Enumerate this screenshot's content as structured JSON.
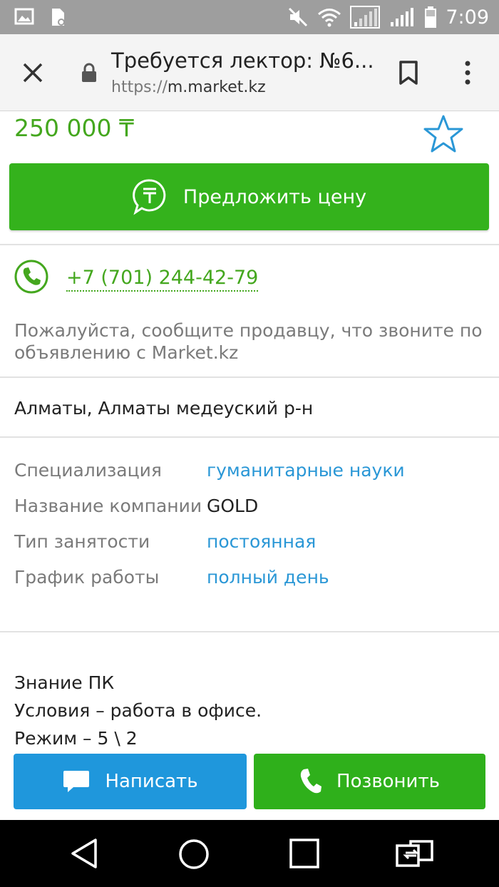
{
  "status_bar": {
    "time": "7:09",
    "icons": [
      "gallery-icon",
      "file-settings-icon",
      "mute-icon",
      "wifi-icon",
      "signal-sim1-icon",
      "signal-sim2-icon",
      "battery-icon"
    ]
  },
  "browser": {
    "title": "Требуется лектор: №6...",
    "url_scheme": "https://",
    "url_host": "m.market.kz"
  },
  "listing": {
    "price": "250 000 ₸",
    "offer_button": "Предложить цену",
    "phone": "+7 (701) 244-42-79",
    "phone_note": "Пожалуйста, сообщите продавцу, что звоните по объявлению с Market.kz",
    "location": "Алматы, Алматы медеуский р-н",
    "params": [
      {
        "label": "Специализация",
        "value": "гуманитарные науки"
      },
      {
        "label": "Название компании",
        "value": "GOLD"
      },
      {
        "label": "Тип занятости",
        "value": "постоянная"
      },
      {
        "label": "График работы",
        "value": "полный день"
      }
    ],
    "description": [
      "Знание ПК",
      "Условия – работа в офисе.",
      "Режим – 5 \\ 2"
    ]
  },
  "actions": {
    "write": "Написать",
    "call": "Позвонить"
  },
  "colors": {
    "green": "#34b21c",
    "blue": "#1f97dc",
    "link": "#2a97d6"
  }
}
